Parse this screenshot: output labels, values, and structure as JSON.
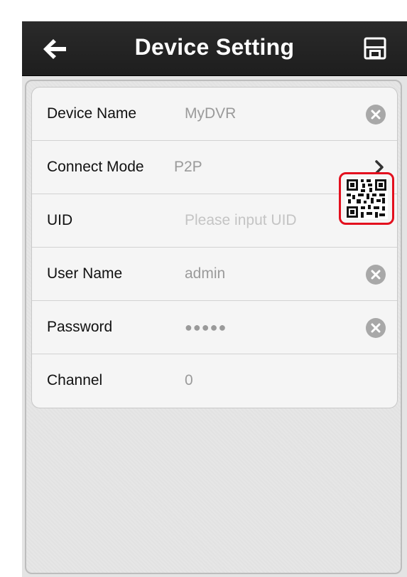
{
  "header": {
    "title": "Device Setting",
    "back_icon": "arrow-left-icon",
    "save_icon": "floppy-disk-icon"
  },
  "form": {
    "device_name": {
      "label": "Device Name",
      "value": "MyDVR"
    },
    "connect_mode": {
      "label": "Connect Mode",
      "value": "P2P"
    },
    "uid": {
      "label": "UID",
      "placeholder": "Please input UID"
    },
    "user_name": {
      "label": "User Name",
      "value": "admin"
    },
    "password": {
      "label": "Password",
      "value": "●●●●●"
    },
    "channel": {
      "label": "Channel",
      "value": "0"
    }
  },
  "colors": {
    "header_bg": "#222222",
    "qr_highlight": "#e3101e",
    "clear_icon": "#a8a8a8"
  }
}
